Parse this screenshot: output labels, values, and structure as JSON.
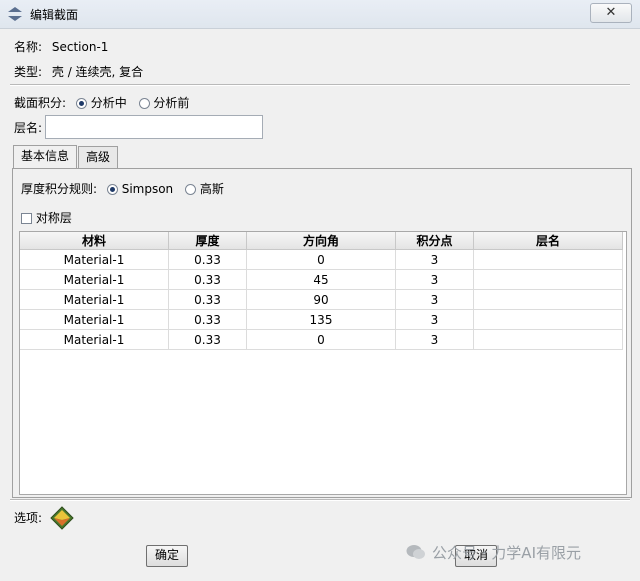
{
  "window": {
    "title": "编辑截面",
    "close_glyph": "✕"
  },
  "name_label": "名称:",
  "name_value": "Section-1",
  "type_label": "类型:",
  "type_value": "壳 / 连续壳, 复合",
  "integration": {
    "label": "截面积分:",
    "options": [
      {
        "label": "分析中",
        "selected": true
      },
      {
        "label": "分析前",
        "selected": false
      }
    ]
  },
  "layer_name": {
    "label": "层名:",
    "value": ""
  },
  "tabs": [
    {
      "label": "基本信息",
      "active": true
    },
    {
      "label": "高级",
      "active": false
    }
  ],
  "thickness_rule": {
    "label": "厚度积分规则:",
    "options": [
      {
        "label": "Simpson",
        "selected": true
      },
      {
        "label": "高斯",
        "selected": false
      }
    ]
  },
  "symmetric": {
    "label": "对称层",
    "checked": false
  },
  "layer_table": {
    "columns": [
      "材料",
      "厚度",
      "方向角",
      "积分点",
      "层名"
    ],
    "rows": [
      [
        "Material-1",
        "0.33",
        "0",
        "3",
        ""
      ],
      [
        "Material-1",
        "0.33",
        "45",
        "3",
        ""
      ],
      [
        "Material-1",
        "0.33",
        "90",
        "3",
        ""
      ],
      [
        "Material-1",
        "0.33",
        "135",
        "3",
        ""
      ],
      [
        "Material-1",
        "0.33",
        "0",
        "3",
        ""
      ]
    ]
  },
  "options_label": "选项:",
  "buttons": {
    "ok": "确定",
    "cancel": "取消"
  },
  "watermark": "公众号 · 力学AI有限元",
  "icons": {
    "title": "edit-section-icon",
    "options": "layup-options-icon",
    "watermark": "wechat-icon"
  }
}
